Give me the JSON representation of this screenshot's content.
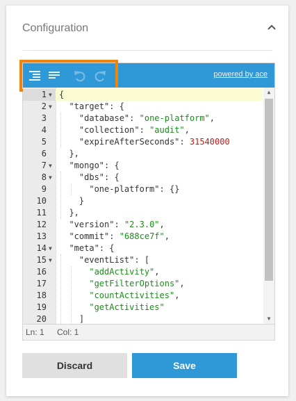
{
  "card": {
    "title": "Configuration",
    "collapse_icon": "chevron-up-icon"
  },
  "editor": {
    "toolbar": {
      "buttons": [
        {
          "icon": "format-indent-icon"
        },
        {
          "icon": "compact-text-icon"
        },
        {
          "icon": "undo-icon",
          "disabled": true
        },
        {
          "icon": "redo-icon",
          "disabled": true
        }
      ],
      "powered_by": "powered by ace"
    },
    "lines": [
      {
        "num": "1",
        "fold": true,
        "code": "{"
      },
      {
        "num": "2",
        "fold": true,
        "code": "  \"target\": {"
      },
      {
        "num": "3",
        "fold": false,
        "code": "    \"database\": \"one-platform\","
      },
      {
        "num": "4",
        "fold": false,
        "code": "    \"collection\": \"audit\","
      },
      {
        "num": "5",
        "fold": false,
        "code": "    \"expireAfterSeconds\": 31540000"
      },
      {
        "num": "6",
        "fold": false,
        "code": "  },"
      },
      {
        "num": "7",
        "fold": true,
        "code": "  \"mongo\": {"
      },
      {
        "num": "8",
        "fold": true,
        "code": "    \"dbs\": {"
      },
      {
        "num": "9",
        "fold": false,
        "code": "      \"one-platform\": {}"
      },
      {
        "num": "10",
        "fold": false,
        "code": "    }"
      },
      {
        "num": "11",
        "fold": false,
        "code": "  },"
      },
      {
        "num": "12",
        "fold": false,
        "code": "  \"version\": \"2.3.0\","
      },
      {
        "num": "13",
        "fold": false,
        "code": "  \"commit\": \"688ce7f\","
      },
      {
        "num": "14",
        "fold": true,
        "code": "  \"meta\": {"
      },
      {
        "num": "15",
        "fold": true,
        "code": "    \"eventList\": ["
      },
      {
        "num": "16",
        "fold": false,
        "code": "      \"addActivity\","
      },
      {
        "num": "17",
        "fold": false,
        "code": "      \"getFilterOptions\","
      },
      {
        "num": "18",
        "fold": false,
        "code": "      \"countActivities\","
      },
      {
        "num": "19",
        "fold": false,
        "code": "      \"getActivities\""
      },
      {
        "num": "20",
        "fold": false,
        "code": "    ]"
      }
    ],
    "status": {
      "line": "Ln: 1",
      "col": "Col: 1"
    }
  },
  "actions": {
    "discard_label": "Discard",
    "save_label": "Save"
  },
  "colors": {
    "accent": "#2f98d6",
    "highlight": "#f0840f",
    "string": "#1a8d1a",
    "number": "#c41a16"
  }
}
